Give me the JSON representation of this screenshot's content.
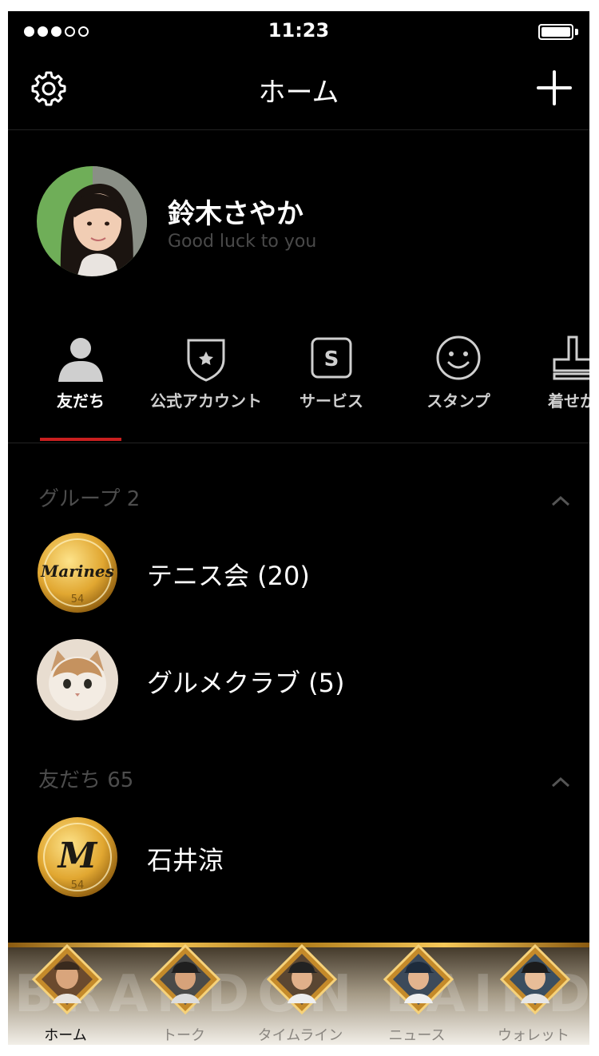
{
  "status_bar": {
    "time": "11:23",
    "signal_dots": 5,
    "signal_filled": 3
  },
  "nav": {
    "title": "ホーム"
  },
  "profile": {
    "name": "鈴木さやか",
    "status_message": "Good luck to you"
  },
  "tabs": [
    {
      "label": "友だち",
      "icon": "person-icon",
      "active": true
    },
    {
      "label": "公式アカウント",
      "icon": "shield-star-icon",
      "active": false
    },
    {
      "label": "サービス",
      "icon": "service-s-icon",
      "active": false
    },
    {
      "label": "スタンプ",
      "icon": "smiley-icon",
      "active": false
    },
    {
      "label": "着せか",
      "icon": "theme-icon",
      "active": false
    }
  ],
  "groups": {
    "header": "グループ 2",
    "items": [
      {
        "name": "テニス会 (20)",
        "avatar": "marines-badge",
        "badge_text": "Marines",
        "badge_number": "54"
      },
      {
        "name": "グルメクラブ (5)",
        "avatar": "cat-photo"
      }
    ]
  },
  "friends": {
    "header": "友だち 65",
    "items": [
      {
        "name": "石井涼",
        "avatar": "m-logo-badge",
        "badge_letter": "M",
        "badge_number": "54"
      }
    ]
  },
  "bottom_tabs": [
    {
      "label": "ホーム",
      "active": true
    },
    {
      "label": "トーク",
      "active": false
    },
    {
      "label": "タイムライン",
      "active": false
    },
    {
      "label": "ニュース",
      "active": false
    },
    {
      "label": "ウォレット",
      "active": false
    }
  ],
  "bottom_banner_text": "BRANDON LAIRD",
  "colors": {
    "background": "#000000",
    "accent": "#c91f1f",
    "gold": "#e8b94a"
  }
}
